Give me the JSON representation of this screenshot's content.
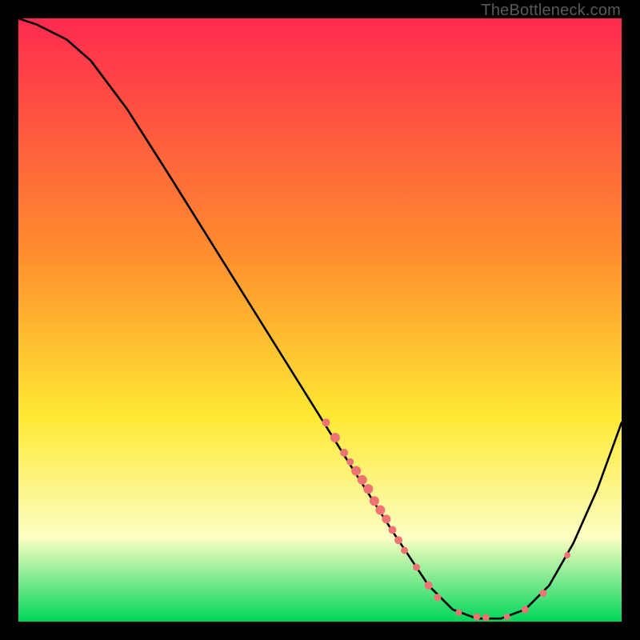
{
  "watermark": "TheBottleneck.com",
  "colors": {
    "gradient_top": "#ff2a4f",
    "gradient_mid1": "#ff8b2e",
    "gradient_mid2": "#ffe933",
    "gradient_mid3": "#fcfec3",
    "gradient_bottom": "#00d65b",
    "curve": "#000000",
    "dot": "#f07373",
    "frame": "#000000"
  },
  "chart_data": {
    "type": "line",
    "title": "",
    "xlabel": "",
    "ylabel": "",
    "xlim": [
      0,
      100
    ],
    "ylim": [
      0,
      100
    ],
    "curve": [
      {
        "x": 0,
        "y": 100
      },
      {
        "x": 3,
        "y": 99
      },
      {
        "x": 8,
        "y": 96.5
      },
      {
        "x": 12,
        "y": 93
      },
      {
        "x": 18,
        "y": 85
      },
      {
        "x": 25,
        "y": 74
      },
      {
        "x": 35,
        "y": 58
      },
      {
        "x": 45,
        "y": 42
      },
      {
        "x": 55,
        "y": 26
      },
      {
        "x": 62,
        "y": 15
      },
      {
        "x": 68,
        "y": 6
      },
      {
        "x": 72,
        "y": 2
      },
      {
        "x": 76,
        "y": 0.5
      },
      {
        "x": 80,
        "y": 0.5
      },
      {
        "x": 84,
        "y": 2
      },
      {
        "x": 88,
        "y": 6
      },
      {
        "x": 92,
        "y": 13
      },
      {
        "x": 96,
        "y": 22
      },
      {
        "x": 100,
        "y": 33
      }
    ],
    "dots": [
      {
        "x": 51,
        "y": 33,
        "r": 5
      },
      {
        "x": 52.5,
        "y": 30.5,
        "r": 6
      },
      {
        "x": 54,
        "y": 28,
        "r": 5
      },
      {
        "x": 55,
        "y": 26.5,
        "r": 4.5
      },
      {
        "x": 56,
        "y": 25,
        "r": 6
      },
      {
        "x": 57,
        "y": 23.5,
        "r": 6
      },
      {
        "x": 58,
        "y": 22,
        "r": 6
      },
      {
        "x": 59,
        "y": 20,
        "r": 6
      },
      {
        "x": 60,
        "y": 18.5,
        "r": 6
      },
      {
        "x": 61,
        "y": 17,
        "r": 5.5
      },
      {
        "x": 62,
        "y": 15.2,
        "r": 5
      },
      {
        "x": 63,
        "y": 13.5,
        "r": 5
      },
      {
        "x": 64,
        "y": 11.8,
        "r": 4.5
      },
      {
        "x": 66,
        "y": 9,
        "r": 4.5
      },
      {
        "x": 68,
        "y": 6,
        "r": 5
      },
      {
        "x": 69.5,
        "y": 4,
        "r": 4.5
      },
      {
        "x": 73,
        "y": 1.5,
        "r": 4
      },
      {
        "x": 76,
        "y": 0.8,
        "r": 4.5
      },
      {
        "x": 77.5,
        "y": 0.7,
        "r": 4.5
      },
      {
        "x": 81,
        "y": 0.8,
        "r": 4
      },
      {
        "x": 84,
        "y": 2,
        "r": 4.5
      },
      {
        "x": 87,
        "y": 4.7,
        "r": 4.5
      },
      {
        "x": 91,
        "y": 11,
        "r": 4
      }
    ]
  }
}
